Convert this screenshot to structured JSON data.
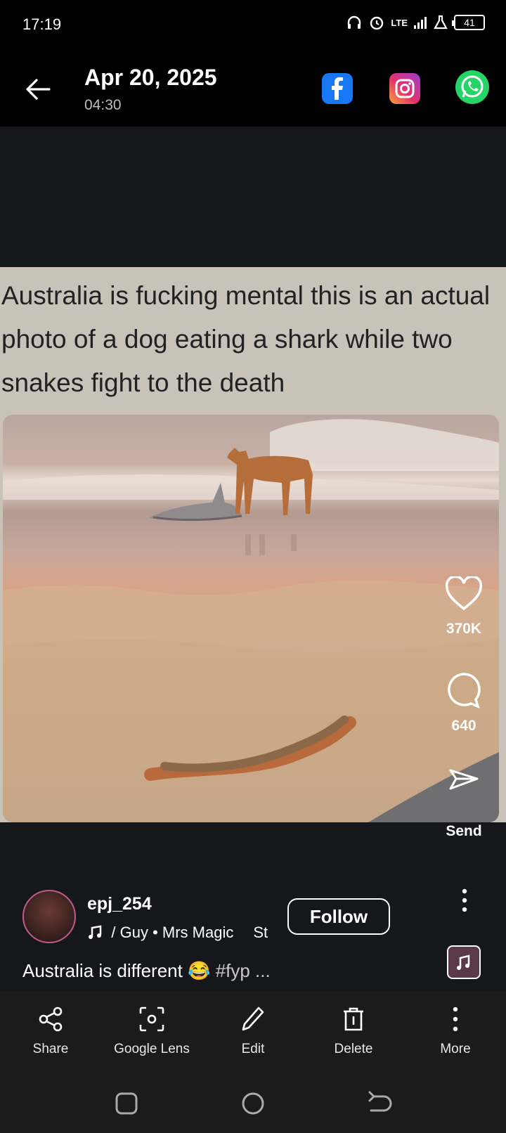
{
  "status": {
    "time": "17:19",
    "network": "LTE",
    "battery": "41"
  },
  "header": {
    "date": "Apr 20, 2025",
    "time": "04:30"
  },
  "post": {
    "meme_text": "Australia is fucking mental this is an actual photo of a dog eating a shark while two snakes fight to the death",
    "likes": "370K",
    "comments": "640",
    "send_label": "Send"
  },
  "author": {
    "username": "epj_254",
    "music": " / Guy • Mrs Magic",
    "music_extra": "St",
    "follow_label": "Follow"
  },
  "caption": {
    "text": "Australia is different 😂",
    "tags": "#fyp ..."
  },
  "bottom_bar": {
    "share": "Share",
    "lens": "Google Lens",
    "edit": "Edit",
    "delete": "Delete",
    "more": "More"
  },
  "icons": {
    "back": "arrow-left-icon",
    "facebook": "facebook-icon",
    "instagram": "instagram-icon",
    "whatsapp": "whatsapp-icon"
  }
}
